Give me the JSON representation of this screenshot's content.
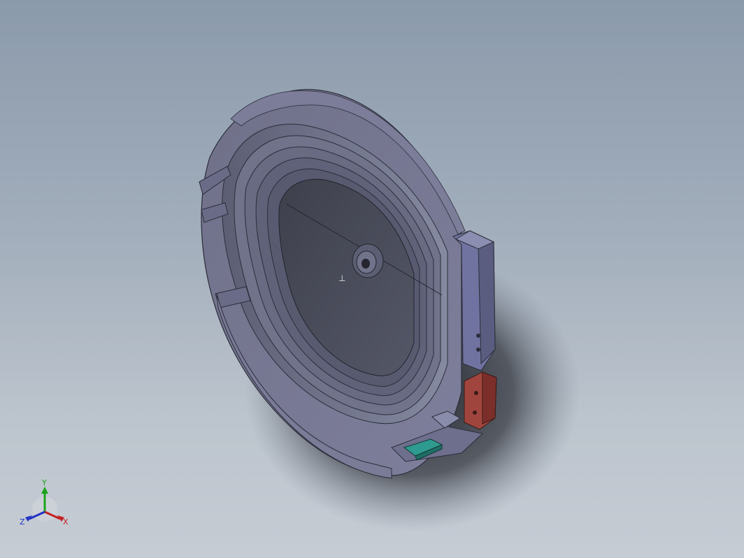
{
  "viewport": {
    "background_top": "#8b9aab",
    "background_bottom": "#c6ccd4"
  },
  "model": {
    "body_color": "#6e6f8e",
    "inner_color": "#4b4e5e",
    "accent_red": "#a0453e",
    "accent_teal": "#2f9a8f",
    "origin_marker": "⊥"
  },
  "triad": {
    "y_label": "Y",
    "x_label": "X",
    "z_label": "Z",
    "y_color": "#1aa31a",
    "x_color": "#c42222",
    "z_color": "#2233c4"
  }
}
